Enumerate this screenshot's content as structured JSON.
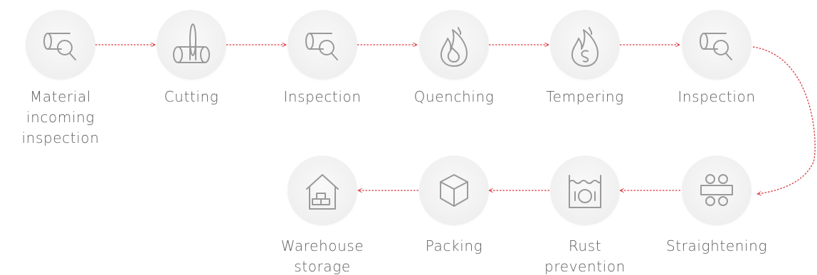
{
  "accent_color": "#d9363e",
  "icon_color": "#9a9a9a",
  "label_color": "#5f5f5f",
  "steps": [
    {
      "label": "Material\nincoming\ninspection",
      "icon": "pipe-magnifier-icon"
    },
    {
      "label": "Cutting",
      "icon": "pipe-cutting-icon"
    },
    {
      "label": "Inspection",
      "icon": "pipe-magnifier-icon"
    },
    {
      "label": "Quenching",
      "icon": "flame-icon"
    },
    {
      "label": "Tempering",
      "icon": "flame-swirl-icon"
    },
    {
      "label": "Inspection",
      "icon": "pipe-magnifier-icon"
    },
    {
      "label": "Straightening",
      "icon": "straightening-rollers-icon"
    },
    {
      "label": "Rust\nprevention",
      "icon": "immersion-tank-icon"
    },
    {
      "label": "Packing",
      "icon": "box-icon"
    },
    {
      "label": "Warehouse\nstorage",
      "icon": "warehouse-icon"
    }
  ]
}
